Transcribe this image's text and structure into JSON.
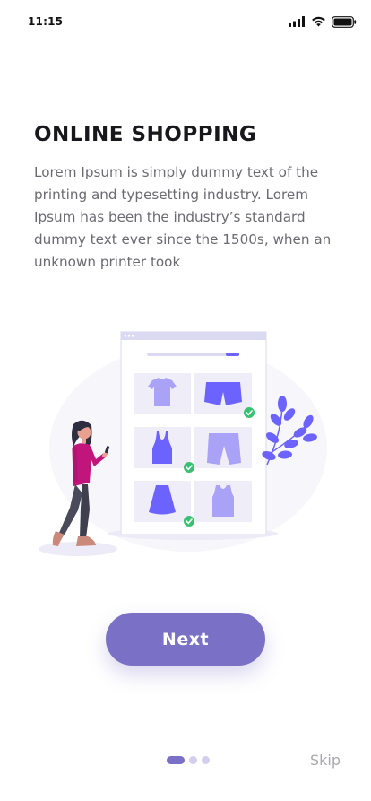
{
  "status_bar": {
    "time": "11:15",
    "icons": [
      "cellular-signal-icon",
      "wifi-icon",
      "battery-icon"
    ]
  },
  "onboarding": {
    "title": "ONLINE SHOPPING",
    "description": "Lorem Ipsum is simply dummy text of the printing and typesetting industry. Lorem Ipsum has been the industry’s standard dummy text ever since the 1500s, when an unknown printer took",
    "illustration": "woman-shopping-on-phone-illustration",
    "next_label": "Next",
    "skip_label": "Skip",
    "page_indicator": {
      "current": 1,
      "total": 3
    }
  },
  "colors": {
    "accent": "#7a71c6",
    "accent_light": "#d2cfee",
    "product": "#6c63ff",
    "product_light": "#a9a2f7",
    "check": "#38c172",
    "title": "#17171c",
    "body_text": "#6a6a72",
    "skip_text": "#a9a9ae"
  }
}
